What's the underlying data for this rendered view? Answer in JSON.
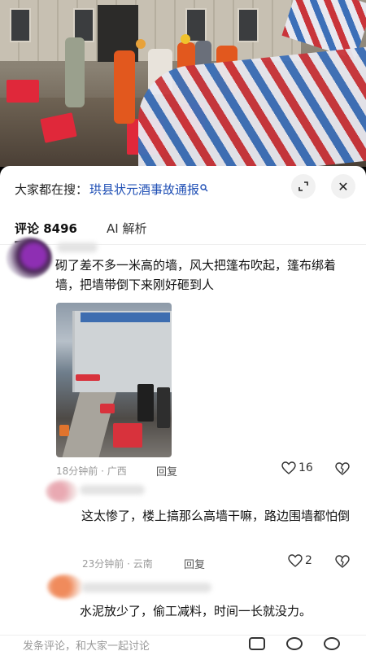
{
  "search": {
    "prefix": "大家都在搜：",
    "topic": "珙县状元酒事故通报",
    "search_icon": "search-icon"
  },
  "buttons": {
    "collapse_icon": "collapse-arrows-icon",
    "close_icon": "close-icon",
    "close_glyph": "✕"
  },
  "tabs": [
    {
      "label": "评论 8496",
      "active": true
    },
    {
      "label": "AI 解析",
      "active": false
    }
  ],
  "comments": [
    {
      "text": "砌了差不多一米高的墙，风大把篷布吹起，篷布绑着墙，把墙带倒下来刚好砸到人",
      "time_location": "18分钟前 · 广西",
      "reply_label": "回复",
      "likes": "16",
      "has_image": true
    },
    {
      "text": "这太惨了，楼上搞那么高墙干嘛，路边围墙都怕倒",
      "time_location": "23分钟前 · 云南",
      "reply_label": "回复",
      "likes": "2"
    },
    {
      "text": "水泥放少了，偷工减料，时间一长就没力。"
    }
  ],
  "bottom_bar": {
    "placeholder": "发条评论，和大家一起讨论",
    "icons": [
      "image-icon",
      "at-icon",
      "emoji-icon"
    ]
  },
  "colors": {
    "topic_blue": "#1f4fb5",
    "text": "#111111",
    "meta_gray": "#9a9a9a"
  }
}
